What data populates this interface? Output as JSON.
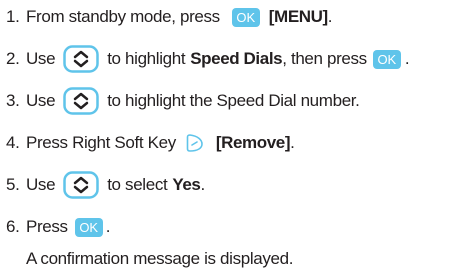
{
  "steps": [
    {
      "num": "1.",
      "t1": "From standby mode, press",
      "key": "OK",
      "t2": "[MENU]",
      "t3": "."
    },
    {
      "num": "2.",
      "t1": "Use",
      "t2": "to highlight",
      "bold": "Speed Dials",
      "t3": ", then press",
      "key": "OK",
      "t4": "."
    },
    {
      "num": "3.",
      "t1": "Use",
      "t2": "to highlight the Speed Dial number."
    },
    {
      "num": "4.",
      "t1": "Press Right Soft Key",
      "t2": "[Remove]",
      "t3": "."
    },
    {
      "num": "5.",
      "t1": "Use",
      "t2": "to select",
      "bold": "Yes",
      "t3": "."
    },
    {
      "num": "6.",
      "t1": "Press",
      "key": "OK",
      "t2": "."
    }
  ],
  "note": "A confirmation message is displayed.",
  "colors": {
    "ok_key": "#5fc4ea",
    "nav_key": "#5fc4ea",
    "soft_key": "#5fc4ea",
    "text": "#231f20"
  },
  "icons": {
    "ok": "ok-key-icon",
    "nav": "navigation-key-icon",
    "soft": "right-soft-key-icon"
  }
}
